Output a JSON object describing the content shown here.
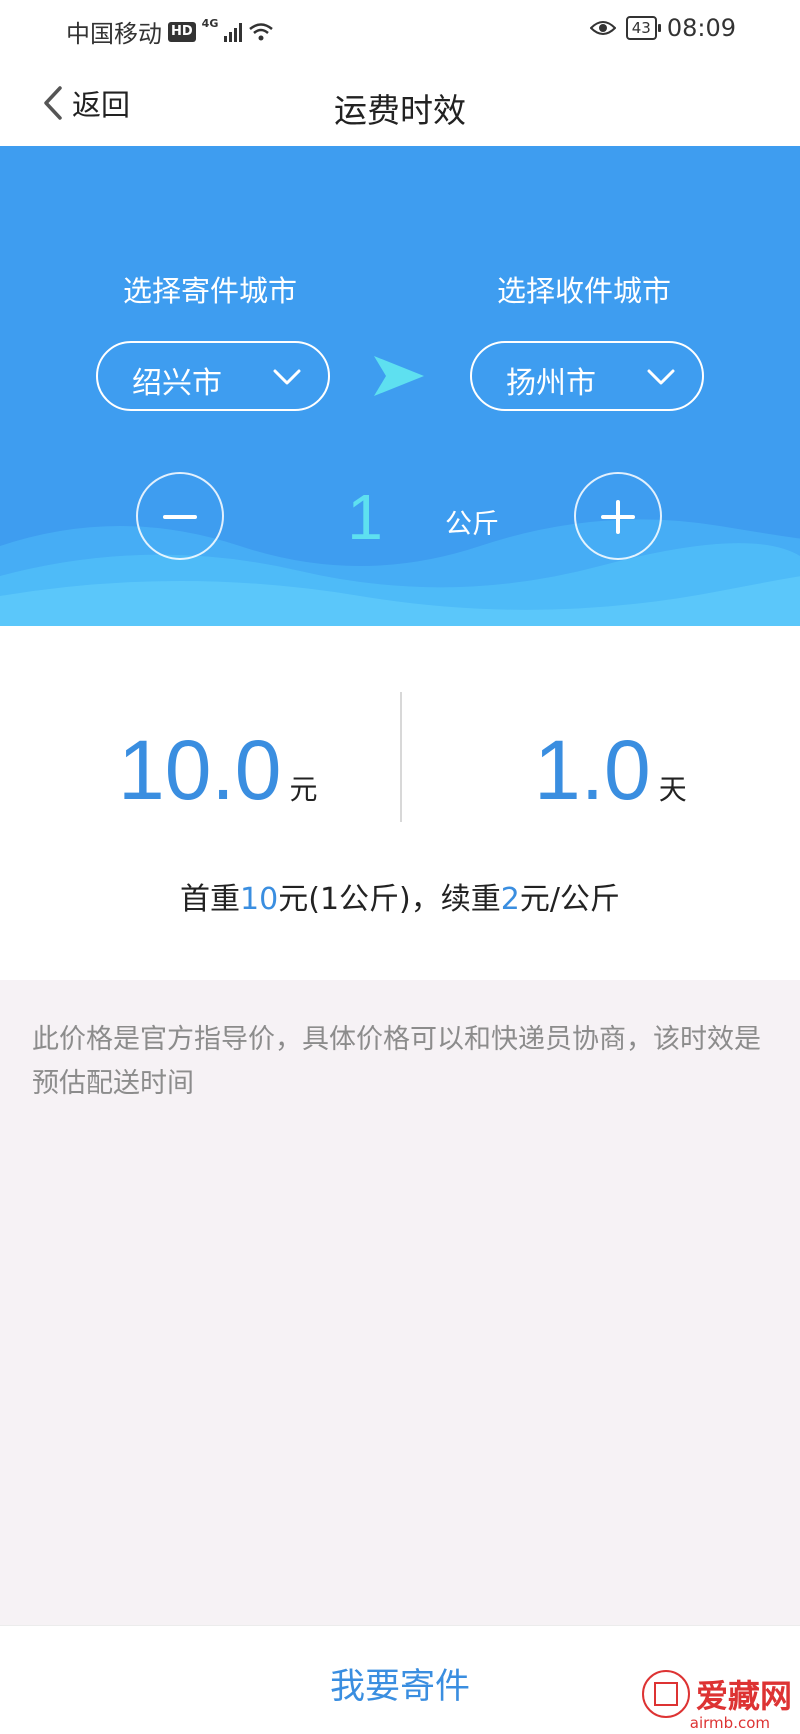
{
  "status_bar": {
    "carrier": "中国移动",
    "hd_badge": "HD",
    "network": "4G",
    "battery": "43",
    "time": "08:09"
  },
  "nav": {
    "back_label": "返回",
    "title": "运费时效"
  },
  "hero": {
    "from_label": "选择寄件城市",
    "to_label": "选择收件城市",
    "from_city": "绍兴市",
    "to_city": "扬州市",
    "weight": "1",
    "weight_unit": "公斤"
  },
  "result": {
    "price": "10.0",
    "price_unit": "元",
    "days": "1.0",
    "days_unit": "天",
    "rule_prefix": "首重",
    "rule_first_price": "10",
    "rule_middle": "元(1公斤)，续重",
    "rule_extra_price": "2",
    "rule_suffix": "元/公斤"
  },
  "notice": {
    "text": "此价格是官方指导价，具体价格可以和快递员协商，该时效是预估配送时间"
  },
  "bottom": {
    "send_label": "我要寄件"
  },
  "watermark": {
    "text": "爱藏网",
    "sub": "airmb.com"
  },
  "colors": {
    "primary_blue": "#3e9df0",
    "accent_blue": "#3a8ee0",
    "weight_cyan": "#5ee0f0",
    "notice_bg": "#f6f2f5"
  }
}
